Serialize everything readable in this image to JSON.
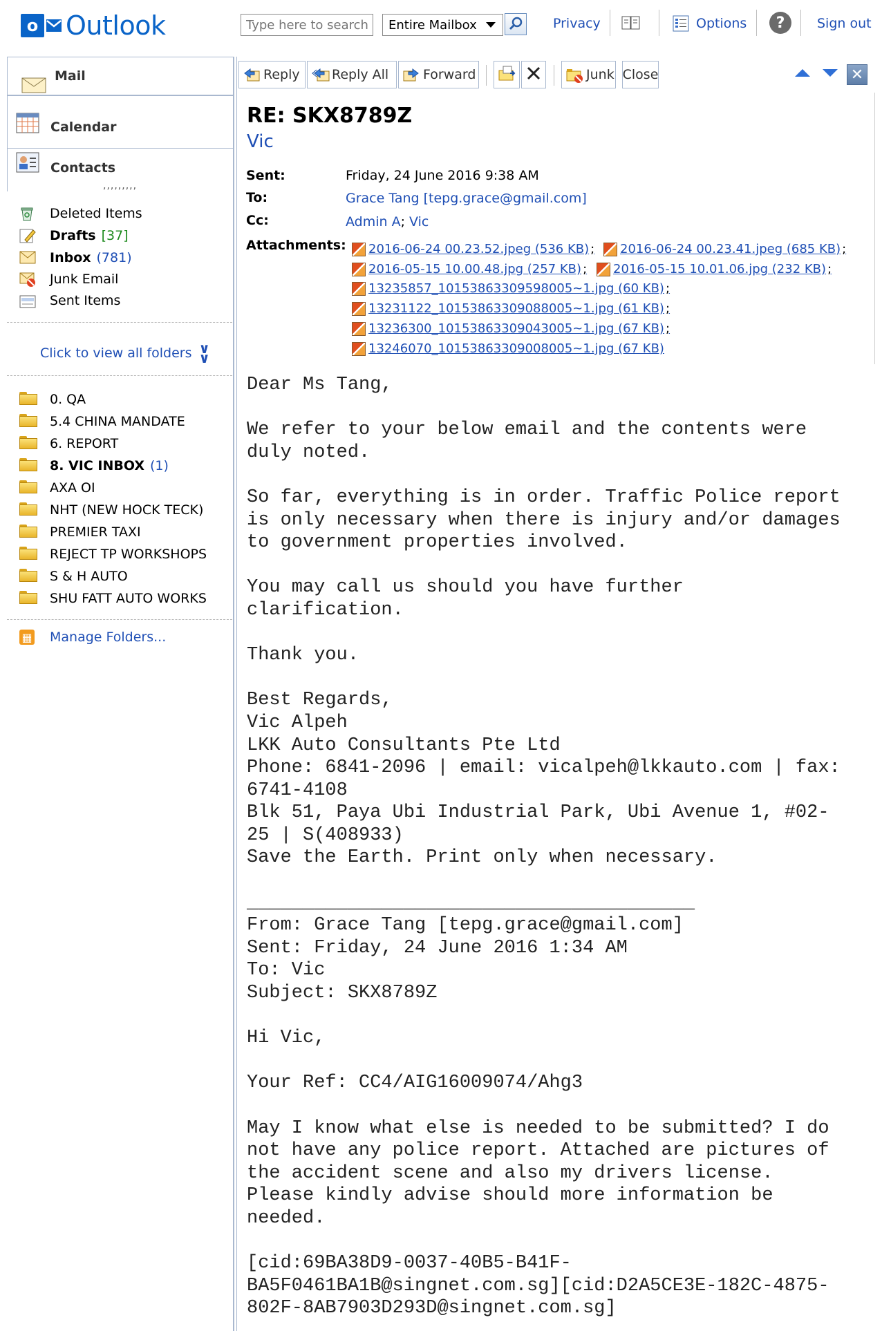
{
  "app": {
    "name": "Outlook",
    "logo_letter": "o"
  },
  "search": {
    "placeholder": "Type here to search",
    "scope": "Entire Mailbox"
  },
  "header_links": {
    "privacy": "Privacy",
    "options": "Options",
    "signout": "Sign out"
  },
  "nav": {
    "mail": "Mail",
    "calendar": "Calendar",
    "contacts": "Contacts",
    "grip": ",,,,,,,,,"
  },
  "folders": [
    {
      "label": "Deleted Items",
      "count": "",
      "bold": false
    },
    {
      "label": "Drafts",
      "count": "[37]",
      "bold": true
    },
    {
      "label": "Inbox",
      "count": "(781)",
      "bold": true
    },
    {
      "label": "Junk Email",
      "count": "",
      "bold": false
    },
    {
      "label": "Sent Items",
      "count": "",
      "bold": false
    }
  ],
  "view_all_folders": "Click to view all folders",
  "custom_folders": [
    {
      "label": "0. QA",
      "count": ""
    },
    {
      "label": "5.4 CHINA MANDATE",
      "count": ""
    },
    {
      "label": "6. REPORT",
      "count": ""
    },
    {
      "label": "8. VIC INBOX",
      "count": "(1)"
    },
    {
      "label": "AXA OI",
      "count": ""
    },
    {
      "label": "NHT (NEW HOCK TECK)",
      "count": ""
    },
    {
      "label": "PREMIER TAXI",
      "count": ""
    },
    {
      "label": "REJECT TP WORKSHOPS",
      "count": ""
    },
    {
      "label": "S & H AUTO",
      "count": ""
    },
    {
      "label": "SHU FATT AUTO WORKS",
      "count": ""
    }
  ],
  "manage_folders": "Manage Folders...",
  "toolbar": {
    "reply": "Reply",
    "reply_all": "Reply All",
    "forward": "Forward",
    "junk": "Junk",
    "close": "Close"
  },
  "message": {
    "subject": "RE: SKX8789Z",
    "sender": "Vic",
    "labels": {
      "sent": "Sent:",
      "to": "To:",
      "cc": "Cc:",
      "attachments": "Attachments:"
    },
    "sent": "Friday, 24 June 2016 9:38 AM",
    "to": "Grace Tang [tepg.grace@gmail.com]",
    "cc": [
      "Admin A",
      "Vic"
    ],
    "attachments": [
      "2016-06-24 00.23.52.jpeg (536 KB)",
      "2016-06-24 00.23.41.jpeg (685 KB)",
      "2016-05-15 10.00.48.jpg (257 KB)",
      "2016-05-15 10.01.06.jpg (232 KB)",
      "13235857_10153863309598005~1.jpg (60 KB)",
      "13231122_10153863309088005~1.jpg (61 KB)",
      "13236300_10153863309043005~1.jpg (67 KB)",
      "13246070_10153863309008005~1.jpg (67 KB)"
    ],
    "body": "Dear Ms Tang,\n\nWe refer to your below email and the contents were\nduly noted.\n\nSo far, everything is in order. Traffic Police report\nis only necessary when there is injury and/or damages\nto government properties involved.\n\nYou may call us should you have further\nclarification.\n\nThank you.\n\nBest Regards,\nVic Alpeh\nLKK Auto Consultants Pte Ltd\nPhone: 6841-2096 | email: vicalpeh@lkkauto.com | fax:\n6741-4108\nBlk 51, Paya Ubi Industrial Park, Ubi Avenue 1, #02-\n25 | S(408933)\nSave the Earth. Print only when necessary.\n\n________________________________________\nFrom: Grace Tang [tepg.grace@gmail.com]\nSent: Friday, 24 June 2016 1:34 AM\nTo: Vic\nSubject: SKX8789Z\n\nHi Vic,\n\nYour Ref: CC4/AIG16009074/Ahg3\n\nMay I know what else is needed to be submitted? I do\nnot have any police report. Attached are pictures of\nthe accident scene and also my drivers license.\nPlease kindly advise should more information be\nneeded.\n\n[cid:69BA38D9-0037-40B5-B41F-\nBA5F0461BA1B@singnet.com.sg][cid:D2A5CE3E-182C-4875-\n802F-8AB7903D293D@singnet.com.sg]"
  }
}
